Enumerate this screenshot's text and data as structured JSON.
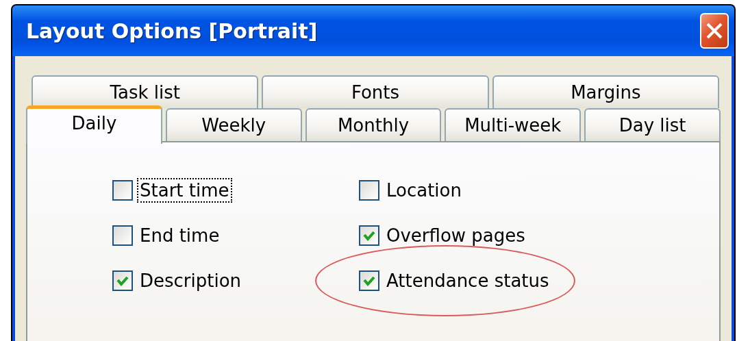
{
  "window": {
    "title": "Layout Options [Portrait]"
  },
  "tab_rows": [
    {
      "tabs": [
        {
          "label": "Task list",
          "selected": false
        },
        {
          "label": "Fonts",
          "selected": false
        },
        {
          "label": "Margins",
          "selected": false
        }
      ]
    },
    {
      "tabs": [
        {
          "label": "Daily",
          "selected": true
        },
        {
          "label": "Weekly",
          "selected": false
        },
        {
          "label": "Monthly",
          "selected": false
        },
        {
          "label": "Multi-week",
          "selected": false
        },
        {
          "label": "Day list",
          "selected": false
        }
      ]
    }
  ],
  "options": [
    {
      "label": "Start time",
      "checked": false,
      "focused": true,
      "highlighted": false
    },
    {
      "label": "Location",
      "checked": false,
      "focused": false,
      "highlighted": false
    },
    {
      "label": "End time",
      "checked": false,
      "focused": false,
      "highlighted": false
    },
    {
      "label": "Overflow pages",
      "checked": true,
      "focused": false,
      "highlighted": false
    },
    {
      "label": "Description",
      "checked": true,
      "focused": false,
      "highlighted": false
    },
    {
      "label": "Attendance status",
      "checked": true,
      "focused": false,
      "highlighted": true
    }
  ]
}
